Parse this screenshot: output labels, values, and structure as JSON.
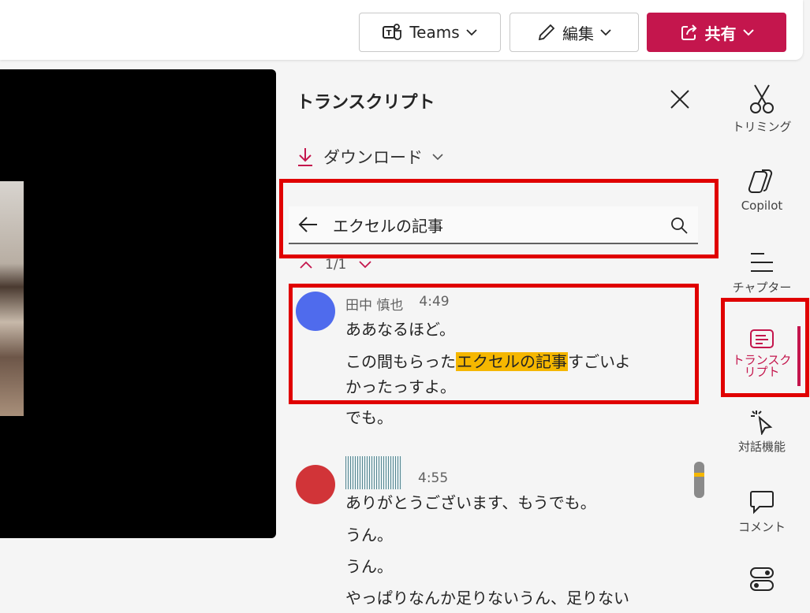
{
  "toolbar": {
    "teams_label": "Teams",
    "edit_label": "編集",
    "share_label": "共有"
  },
  "transcript": {
    "title": "トランスクリプト",
    "download_label": "ダウンロード",
    "search_value": "エクセルの記事",
    "match_count": "1/1",
    "entries": [
      {
        "speaker": "田中 慎也",
        "time": "4:49",
        "avatar_color": "#4f6bed",
        "lines": [
          "ああなるほど。",
          "この間もらった",
          "エクセルの記事",
          "すごいよ",
          "かったっすよ。",
          "でも。"
        ]
      },
      {
        "speaker": "",
        "time": "4:55",
        "avatar_color": "#d13438",
        "lines": [
          "ありがとうございます、もうでも。",
          "うん。",
          "うん。",
          "やっぱりなんか足りないうん、足りない"
        ]
      }
    ]
  },
  "rail": {
    "items": [
      {
        "label": "トリミング",
        "icon": "scissors-icon"
      },
      {
        "label": "Copilot",
        "icon": "copilot-icon"
      },
      {
        "label": "チャプター",
        "icon": "chapters-icon"
      },
      {
        "label": "トランスク",
        "label2": "リプト",
        "icon": "transcript-icon"
      },
      {
        "label": "対話機能",
        "icon": "interactive-icon"
      },
      {
        "label": "コメント",
        "icon": "comment-icon"
      }
    ]
  },
  "colors": {
    "accent": "#c4164d",
    "highlight": "#f5b700",
    "annotation_red": "#e00000"
  }
}
